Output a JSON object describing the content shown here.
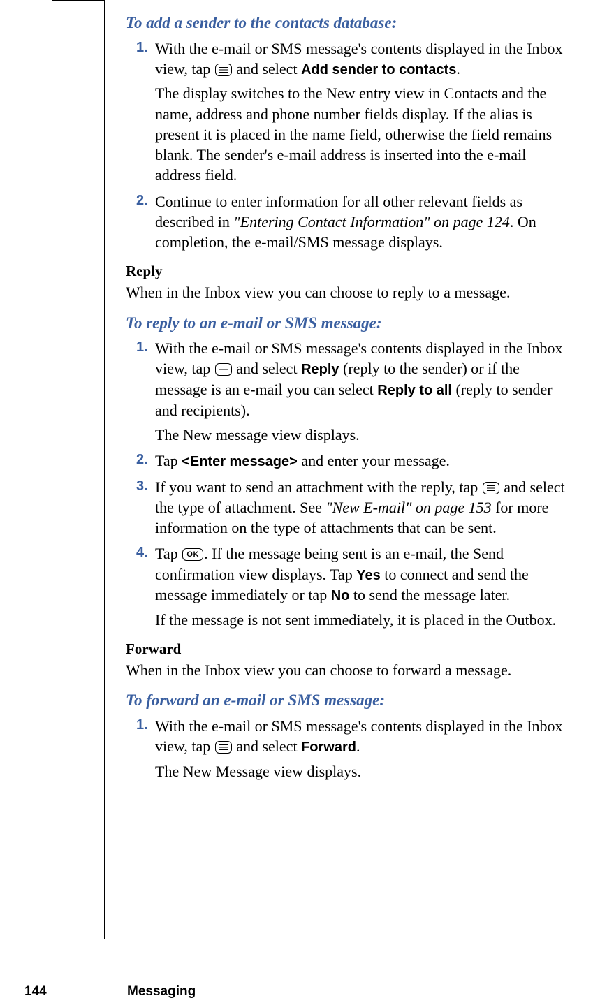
{
  "footer": {
    "page_number": "144",
    "section": "Messaging"
  },
  "sections": {
    "add_sender": {
      "heading": "To add a sender to the contacts database:",
      "step1_a": "With the e-mail or SMS message's contents displayed in the Inbox view, tap ",
      "step1_b": " and select ",
      "step1_bold": "Add sender to contacts",
      "step1_c": ".",
      "step1_follow": "The display switches to the New entry view in Contacts and the name, address and phone number fields display. If the alias is present it is placed in the name field, otherwise the field remains blank. The sender's e-mail address is inserted into the e-mail address field.",
      "step2_a": "Continue to enter information for all other relevant fields as described in ",
      "step2_ref": "\"Entering Contact Information\" on page 124",
      "step2_b": ". On completion, the e-mail/SMS message displays."
    },
    "reply": {
      "subhead": "Reply",
      "intro": "When in the Inbox view you can choose to reply to a message.",
      "heading": "To reply to an e-mail or SMS message:",
      "step1_a": "With the e-mail or SMS message's contents displayed in the Inbox view, tap ",
      "step1_b": " and select ",
      "step1_bold1": "Reply",
      "step1_c": " (reply to the sender) or if the message is an e-mail you can select ",
      "step1_bold2": "Reply to all",
      "step1_d": " (reply to sender and recipients).",
      "step1_follow": "The New message view displays.",
      "step2_a": "Tap ",
      "step2_bold": "<Enter message>",
      "step2_b": " and enter your message.",
      "step3_a": "If you want to send an attachment with the reply, tap ",
      "step3_b": " and select the type of attachment. See ",
      "step3_ref": "\"New E-mail\" on page 153",
      "step3_c": " for more information on the type of attachments that can be sent.",
      "step4_a": "Tap ",
      "step4_b": ". If the message being sent is an e-mail, the Send confirmation view displays. Tap ",
      "step4_bold1": "Yes",
      "step4_c": " to connect and send the message immediately or tap ",
      "step4_bold2": "No",
      "step4_d": " to send the message later.",
      "step4_follow": "If the message is not sent immediately, it is placed in the Outbox."
    },
    "forward": {
      "subhead": "Forward",
      "intro": "When in the Inbox view you can choose to forward a message.",
      "heading": "To forward an e-mail or SMS message:",
      "step1_a": "With the e-mail or SMS message's contents displayed in the Inbox view, tap ",
      "step1_b": " and select ",
      "step1_bold": "Forward",
      "step1_c": ".",
      "step1_follow": "The New Message view displays."
    }
  },
  "step_numbers": {
    "n1": "1.",
    "n2": "2.",
    "n3": "3.",
    "n4": "4."
  }
}
